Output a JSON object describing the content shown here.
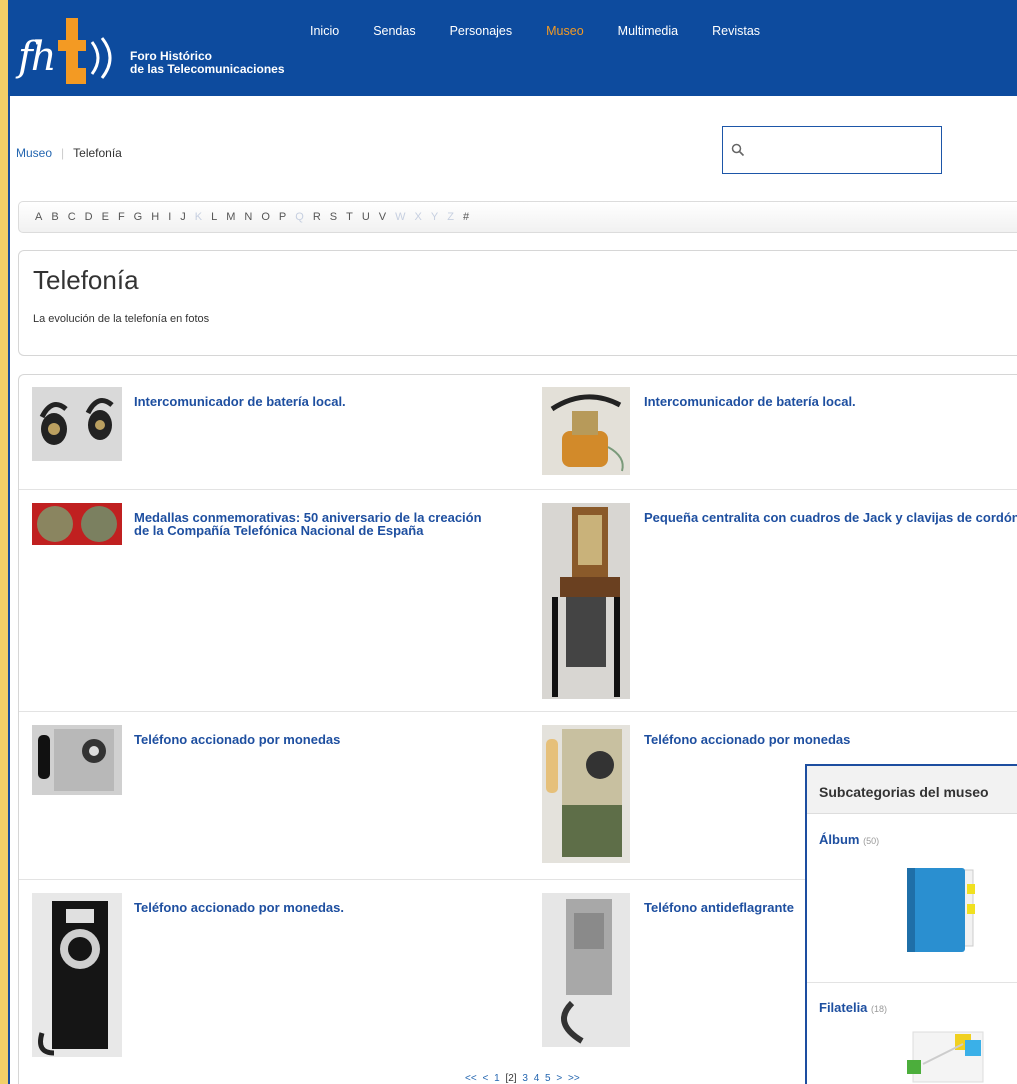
{
  "header": {
    "logo_text_line1": "Foro Histórico",
    "logo_text_line2": "de las Telecomunicaciones",
    "nav": [
      {
        "label": "Inicio",
        "active": false
      },
      {
        "label": "Sendas",
        "active": false
      },
      {
        "label": "Personajes",
        "active": false
      },
      {
        "label": "Museo",
        "active": true
      },
      {
        "label": "Multimedia",
        "active": false
      },
      {
        "label": "Revistas",
        "active": false
      }
    ]
  },
  "breadcrumb": {
    "root": "Museo",
    "current": "Telefonía"
  },
  "search": {
    "placeholder": "",
    "value": ""
  },
  "alphabet": [
    {
      "l": "A",
      "on": true
    },
    {
      "l": "B",
      "on": true
    },
    {
      "l": "C",
      "on": true
    },
    {
      "l": "D",
      "on": true
    },
    {
      "l": "E",
      "on": true
    },
    {
      "l": "F",
      "on": true
    },
    {
      "l": "G",
      "on": true
    },
    {
      "l": "H",
      "on": true
    },
    {
      "l": "I",
      "on": true
    },
    {
      "l": "J",
      "on": true
    },
    {
      "l": "K",
      "on": false
    },
    {
      "l": "L",
      "on": true
    },
    {
      "l": "M",
      "on": true
    },
    {
      "l": "N",
      "on": true
    },
    {
      "l": "O",
      "on": true
    },
    {
      "l": "P",
      "on": true
    },
    {
      "l": "Q",
      "on": false
    },
    {
      "l": "R",
      "on": true
    },
    {
      "l": "S",
      "on": true
    },
    {
      "l": "T",
      "on": true
    },
    {
      "l": "U",
      "on": true
    },
    {
      "l": "V",
      "on": true
    },
    {
      "l": "W",
      "on": false
    },
    {
      "l": "X",
      "on": false
    },
    {
      "l": "Y",
      "on": false
    },
    {
      "l": "Z",
      "on": false
    },
    {
      "l": "#",
      "on": true
    }
  ],
  "category": {
    "title": "Telefonía",
    "description": "La evolución de la telefonía en fotos"
  },
  "items": [
    {
      "title": "Intercomunicador de batería local."
    },
    {
      "title": "Intercomunicador de batería local."
    },
    {
      "title": "Medallas conmemorativas: 50 aniversario de la creación de la Compañía Telefónica Nacional de España"
    },
    {
      "title": "Pequeña centralita con cuadros de Jack y clavijas de cordón."
    },
    {
      "title": "Teléfono accionado por monedas"
    },
    {
      "title": "Teléfono accionado por monedas"
    },
    {
      "title": "Teléfono accionado por monedas."
    },
    {
      "title": "Teléfono antideflagrante"
    }
  ],
  "pager": {
    "first": "<<",
    "prev": "<",
    "pages": [
      "1",
      "[2]",
      "3",
      "4",
      "5"
    ],
    "next": ">",
    "last": ">>"
  },
  "subcategories": {
    "heading": "Subcategorias del museo",
    "list": [
      {
        "name": "Álbum",
        "count": "(50)"
      },
      {
        "name": "Filatelia",
        "count": "(18)"
      }
    ]
  }
}
